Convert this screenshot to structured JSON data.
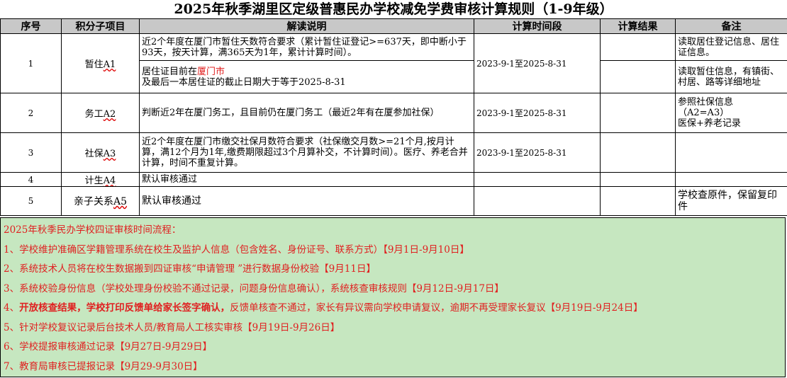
{
  "title": "2025年秋季湖里区定级普惠民办学校减免学费审核计算规则（1-9年级）",
  "headers": {
    "seq": "序号",
    "item": "积分子项目",
    "desc": "解读说明",
    "period": "计算时间段",
    "result": "计算结果",
    "remark": "备注"
  },
  "rows": {
    "r1": {
      "seq": "1",
      "item_text": "暂住",
      "item_code": "A1",
      "desc_a": "近2个年度在厦门市暂住天数符合要求（累计暂住证登记>=637天，即中断小于93天，按天计算，满365天为1年，累计计算时间）。",
      "desc_b_pre": "居住证目前在",
      "desc_b_city": "厦门市",
      "desc_b_post": "及最后一本居住证的截止日期大于等于2025-8-31",
      "period": "2023-9-1至2025-8-31",
      "remark_a": "读取居住登记信息、居住证信息。",
      "remark_b": "读取暂住信息，有镇街、村居、路等详细地址"
    },
    "r2": {
      "seq": "2",
      "item_text": "务工",
      "item_code": "A2",
      "desc": "判断近2年在厦门务工，且目前仍在厦门务工（最近2年有在厦参加社保）",
      "period": "2023-9-1至2025-8-31",
      "remark_l1": "参照社保信息",
      "remark_l2": "（A2=A3）",
      "remark_l3": "医保+养老记录"
    },
    "r3": {
      "seq": "3",
      "item_text": "社保",
      "item_code": "A3",
      "desc": "近2个年度在厦门市缴交社保月数符合要求（社保缴交月数>=21个月,按月计算，满12个月为1年,缴费期限超过3个月算补交，不计算时间）。医疗、养老合并计算，时间不重复计算。",
      "period": "2023-9-1至2025-8-31"
    },
    "r4": {
      "seq": "4",
      "item_text": "计生",
      "item_code": "A4",
      "desc": "默认审核通过"
    },
    "r5": {
      "seq": "5",
      "item_text": "亲子关系",
      "item_code": "A5",
      "desc": "默认审核通过",
      "remark": "学校查原件，保留复印件"
    }
  },
  "flow": {
    "heading": "2025年秋季民办学校四证审核时间流程：",
    "s1": "1、学校维护准确区学籍管理系统在校生及监护人信息（包含姓名、身份证号、联系方式）【9月1日-9月10日】",
    "s2": "2、系统技术人员将在校生数据搬到四证审核“申请管理 ”进行数据身份校验【9月11日】",
    "s3": "3、系统校验身份信息（学校处理身份校验不通过记录，问题身份信息确认），系统核查审核规则【9月12日-9月17日】",
    "s4_num": "4、",
    "s4_bold": "开放核查结果，学校打印反馈单给家长签字确认，",
    "s4_rest": "反馈单核查不通过，家长有异议需向学校申请复议，逾期不再受理家长复议【9月19日-9月24日】",
    "s5": "5、针对学校复议记录后台技术人员/教育局人工核实审核【9月19日-9月26日】",
    "s6": "6、学校提报审核通过记录【9月27日-9月29日】",
    "s7": "7、教育局审核已提报记录【9月29-9月30日】"
  }
}
